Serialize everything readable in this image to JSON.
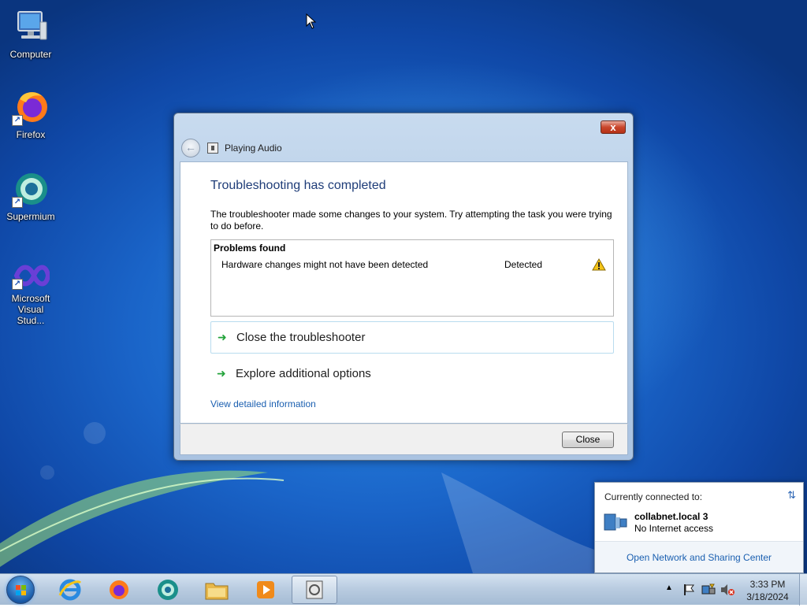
{
  "desktop": {
    "icons": [
      {
        "label": "Computer"
      },
      {
        "label": "Firefox"
      },
      {
        "label": "Supermium"
      },
      {
        "label": "Microsoft Visual Stud..."
      }
    ]
  },
  "dialog": {
    "nav_title": "Playing Audio",
    "headline": "Troubleshooting has completed",
    "description": "The troubleshooter made some changes to your system. Try attempting the task you were trying to do before.",
    "problems": {
      "header": "Problems found",
      "rows": [
        {
          "name": "Hardware changes might not have been detected",
          "status": "Detected"
        }
      ]
    },
    "options": [
      {
        "label": "Close the troubleshooter"
      },
      {
        "label": "Explore additional options"
      }
    ],
    "detail_link": "View detailed information",
    "close_button": "Close",
    "close_x": "x"
  },
  "network_popup": {
    "header": "Currently connected to:",
    "network_name": "collabnet.local  3",
    "network_status": "No Internet access",
    "footer_link": "Open Network and Sharing Center"
  },
  "taskbar": {
    "time": "3:33 PM",
    "date": "3/18/2024",
    "pinned": [
      "internet-explorer-icon",
      "firefox-icon",
      "supermium-icon",
      "file-explorer-icon",
      "media-player-icon",
      "troubleshooter-icon"
    ]
  }
}
